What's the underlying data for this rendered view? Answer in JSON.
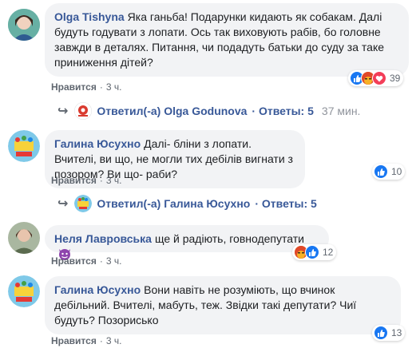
{
  "comments": [
    {
      "author": "Olga Tishyna",
      "text": "Яка ганьба! Подарунки кидають як собакам. Далі будуть годувати з лопати. Ось так виховують рабів, бо головне завжди в деталях. Питання, чи подадуть батьки до суду за таке приниження дітей?",
      "like_label": "Нравится",
      "time": "3 ч.",
      "reaction_count": "39",
      "reactions": [
        "like-icon",
        "angry-icon",
        "love-icon"
      ]
    },
    {
      "author": "Галина Юсухно",
      "text": "Далі- бліни з лопати. Вчителі, ви що, не могли тих дебілів вигнати з позором? Ви що- раби?",
      "like_label": "Нравится",
      "time": "3 ч.",
      "reaction_count": "10",
      "reactions": [
        "like-icon"
      ]
    },
    {
      "author": "Неля Лавровська",
      "text": "ще й радіють, говнодепутати",
      "like_label": "Нравится",
      "time": "3 ч.",
      "reaction_count": "12",
      "reactions": [
        "angry-icon",
        "like-icon"
      ]
    },
    {
      "author": "Галина Юсухно",
      "text": "Вони навіть не розуміють, що вчинок дебільний. Вчителі, мабуть, теж. Звідки такі депутати? Чиї будуть? Позорисько",
      "like_label": "Нравится",
      "time": "3 ч.",
      "reaction_count": "13",
      "reactions": [
        "like-icon"
      ]
    }
  ],
  "reply_rows": [
    {
      "label": "Ответил(-а) Olga Godunova",
      "meta": "· Ответы: 5",
      "time": "37 мин."
    },
    {
      "label": "Ответил(-а) Галина Юсухно",
      "meta": "· Ответы: 5",
      "time": ""
    }
  ],
  "colors": {
    "link": "#385898",
    "bubble": "#f2f3f5",
    "muted": "#606770",
    "like_blue": "#1877f2",
    "angry_orange": "#f7b125",
    "love_red": "#f33e58"
  }
}
